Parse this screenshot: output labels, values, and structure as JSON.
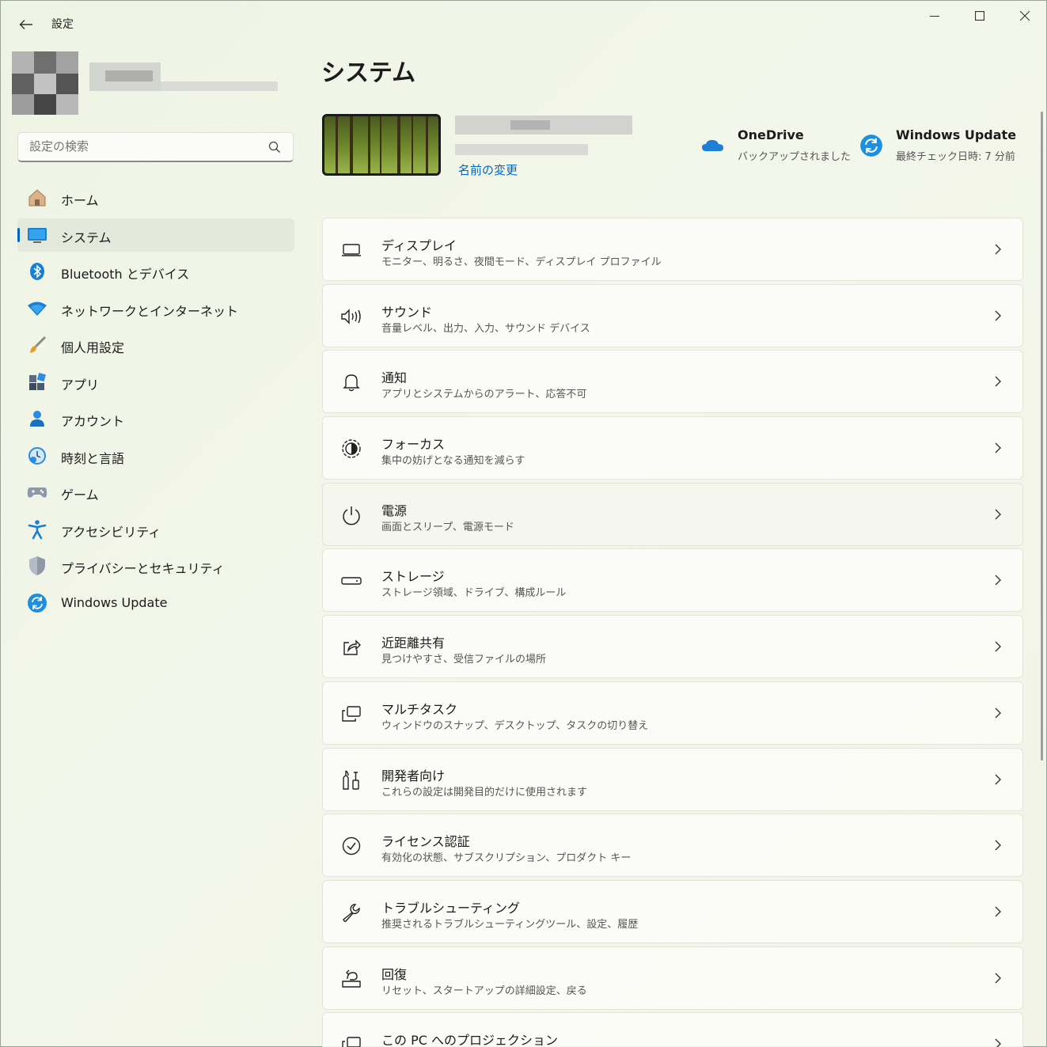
{
  "window": {
    "title": "設定",
    "controls": {
      "minimize": "—",
      "maximize": "☐",
      "close": "✕"
    }
  },
  "search": {
    "placeholder": "設定の検索"
  },
  "sidebar": {
    "items": [
      {
        "label": "ホーム",
        "icon": "home-icon"
      },
      {
        "label": "システム",
        "icon": "system-icon",
        "selected": true
      },
      {
        "label": "Bluetooth とデバイス",
        "icon": "bluetooth-icon"
      },
      {
        "label": "ネットワークとインターネット",
        "icon": "network-icon"
      },
      {
        "label": "個人用設定",
        "icon": "personalization-icon"
      },
      {
        "label": "アプリ",
        "icon": "apps-icon"
      },
      {
        "label": "アカウント",
        "icon": "accounts-icon"
      },
      {
        "label": "時刻と言語",
        "icon": "time-language-icon"
      },
      {
        "label": "ゲーム",
        "icon": "gaming-icon"
      },
      {
        "label": "アクセシビリティ",
        "icon": "accessibility-icon"
      },
      {
        "label": "プライバシーとセキュリティ",
        "icon": "privacy-icon"
      },
      {
        "label": "Windows Update",
        "icon": "windows-update-icon"
      }
    ]
  },
  "main": {
    "title": "システム",
    "device": {
      "rename_link": "名前の変更"
    },
    "status": [
      {
        "title": "OneDrive",
        "subtitle": "バックアップされました",
        "icon": "onedrive-icon"
      },
      {
        "title": "Windows Update",
        "subtitle": "最終チェック日時: 7 分前",
        "icon": "windows-update-icon"
      }
    ],
    "settings": [
      {
        "title": "ディスプレイ",
        "subtitle": "モニター、明るさ、夜間モード、ディスプレイ プロファイル",
        "icon": "display-icon"
      },
      {
        "title": "サウンド",
        "subtitle": "音量レベル、出力、入力、サウンド デバイス",
        "icon": "sound-icon"
      },
      {
        "title": "通知",
        "subtitle": "アプリとシステムからのアラート、応答不可",
        "icon": "notification-icon"
      },
      {
        "title": "フォーカス",
        "subtitle": "集中の妨げとなる通知を減らす",
        "icon": "focus-icon"
      },
      {
        "title": "電源",
        "subtitle": "画面とスリープ、電源モード",
        "icon": "power-icon"
      },
      {
        "title": "ストレージ",
        "subtitle": "ストレージ領域、ドライブ、構成ルール",
        "icon": "storage-icon"
      },
      {
        "title": "近距離共有",
        "subtitle": "見つけやすさ、受信ファイルの場所",
        "icon": "nearby-share-icon"
      },
      {
        "title": "マルチタスク",
        "subtitle": "ウィンドウのスナップ、デスクトップ、タスクの切り替え",
        "icon": "multitasking-icon"
      },
      {
        "title": "開発者向け",
        "subtitle": "これらの設定は開発目的だけに使用されます",
        "icon": "developer-icon"
      },
      {
        "title": "ライセンス認証",
        "subtitle": "有効化の状態、サブスクリプション、プロダクト キー",
        "icon": "activation-icon"
      },
      {
        "title": "トラブルシューティング",
        "subtitle": "推奨されるトラブルシューティングツール、設定、履歴",
        "icon": "troubleshoot-icon"
      },
      {
        "title": "回復",
        "subtitle": "リセット、スタートアップの詳細設定、戻る",
        "icon": "recovery-icon"
      },
      {
        "title": "この PC へのプロジェクション",
        "subtitle": "",
        "icon": "projection-icon"
      }
    ]
  },
  "colors": {
    "accent": "#0067c0",
    "selected_bg": "#e4e9dc",
    "onedrive": "#1f7fd6",
    "update": "#1e8fe0"
  }
}
